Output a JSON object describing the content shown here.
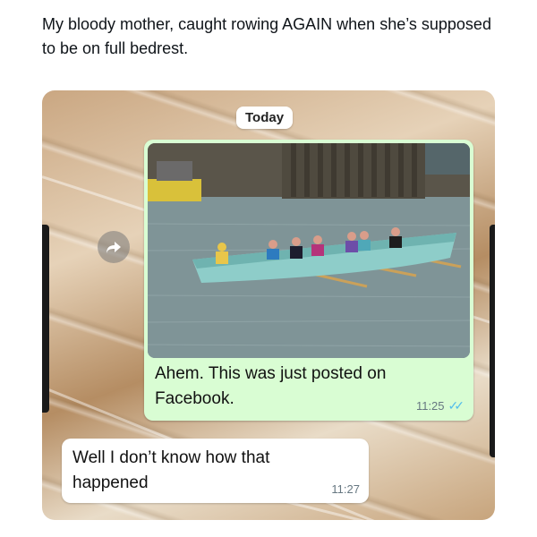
{
  "post": {
    "caption": "My bloody mother, caught rowing AGAIN when she’s supposed to be on full bedrest."
  },
  "chat": {
    "date_chip": "Today",
    "messages": [
      {
        "direction": "outgoing",
        "has_image": true,
        "text": "Ahem. This was just posted on Facebook.",
        "time": "11:25",
        "status": "read",
        "status_icon": "double-check-icon"
      },
      {
        "direction": "incoming",
        "text": "Well I don’t know how that happened",
        "time": "11:27"
      }
    ],
    "forward_icon": "forward-arrow-icon"
  },
  "colors": {
    "outgoing_bubble": "#d9fdd3",
    "incoming_bubble": "#ffffff",
    "read_ticks": "#53bdeb",
    "boat": "#8ecdc9"
  }
}
